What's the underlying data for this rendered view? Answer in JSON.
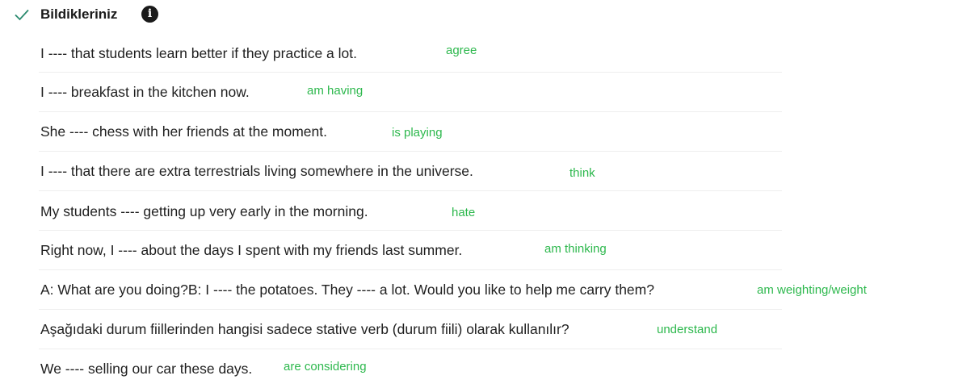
{
  "header": {
    "title": "Bildikleriniz",
    "status_icon": "check-icon",
    "info_icon": "info-icon",
    "info_glyph": "i"
  },
  "accent_color": "#2db84d",
  "items": [
    {
      "question": "I ---- that students learn better if they practice a lot.",
      "answer": "agree"
    },
    {
      "question": "I ---- breakfast in the kitchen now.",
      "answer": "am having"
    },
    {
      "question": "She ---- chess with her friends at the moment.",
      "answer": "is playing"
    },
    {
      "question": "I ---- that there are extra terrestrials living somewhere in the universe.",
      "answer": "think"
    },
    {
      "question": "My students ---- getting up very early in the morning.",
      "answer": "hate"
    },
    {
      "question": "Right now, I ---- about the days I spent with my friends last summer.",
      "answer": "am thinking"
    },
    {
      "question": "A: What are you doing?B: I ---- the potatoes. They ---- a lot. Would you like to help me carry them?",
      "answer": "am weighting/weight"
    },
    {
      "question": "Aşağıdaki durum fiillerinden hangisi sadece stative verb (durum fiili) olarak kullanılır?",
      "answer": "understand"
    },
    {
      "question": "We ---- selling our car these days.",
      "answer": "are considering"
    }
  ]
}
